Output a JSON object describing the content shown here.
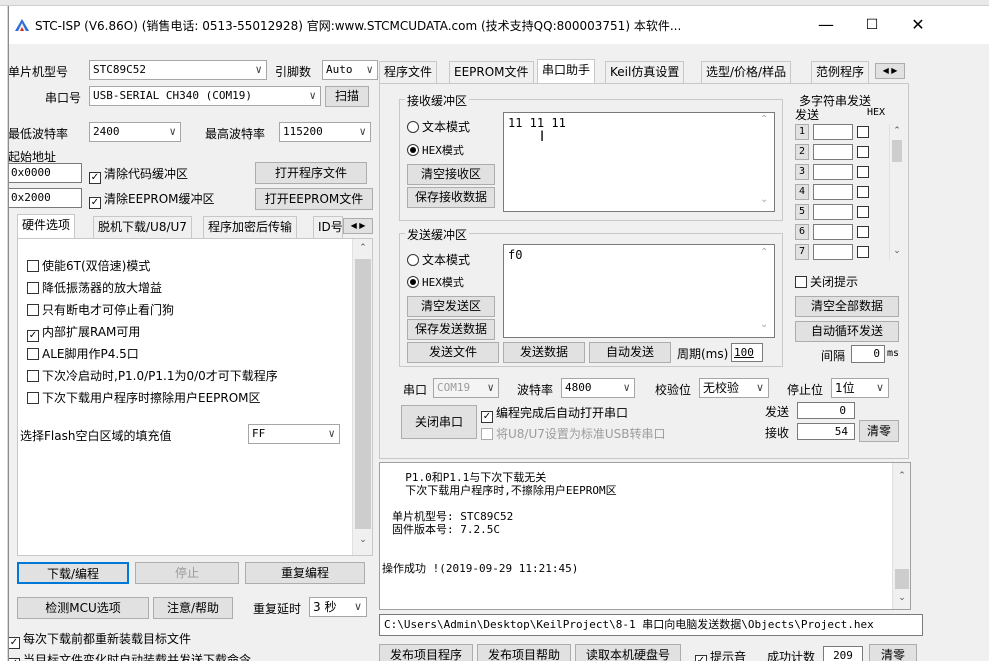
{
  "window": {
    "title": "STC-ISP (V6.86O) (销售电话: 0513-55012928) 官网:www.STCMCUDATA.com  (技术支持QQ:800003751) 本软件...",
    "minimize": "—",
    "maximize": "☐",
    "close": "✕"
  },
  "left": {
    "mcu_label": "单片机型号",
    "mcu_value": "STC89C52",
    "pins_label": "引脚数",
    "pins_value": "Auto",
    "port_label": "串口号",
    "port_value": "USB-SERIAL CH340 (COM19)",
    "scan_button": "扫描",
    "min_baud_label": "最低波特率",
    "min_baud_value": "2400",
    "max_baud_label": "最高波特率",
    "max_baud_value": "115200",
    "start_addr_label": "起始地址",
    "addr1_value": "0x0000",
    "clear_code_label": "清除代码缓冲区",
    "open_program_button": "打开程序文件",
    "addr2_value": "0x2000",
    "clear_eeprom_label": "清除EEPROM缓冲区",
    "open_eeprom_button": "打开EEPROM文件",
    "tabs": [
      "硬件选项",
      "脱机下载/U8/U7",
      "程序加密后传输",
      "ID号"
    ],
    "options": [
      {
        "label": "使能6T(双倍速)模式",
        "checked": false
      },
      {
        "label": "降低振荡器的放大增益",
        "checked": false
      },
      {
        "label": "只有断电才可停止看门狗",
        "checked": false
      },
      {
        "label": "内部扩展RAM可用",
        "checked": true
      },
      {
        "label": "ALE脚用作P4.5口",
        "checked": false
      },
      {
        "label": "下次冷启动时,P1.0/P1.1为0/0才可下载程序",
        "checked": false
      },
      {
        "label": "下次下载用户程序时擦除用户EEPROM区",
        "checked": false
      }
    ],
    "fill_label": "选择Flash空白区域的填充值",
    "fill_value": "FF",
    "download_button": "下载/编程",
    "stop_button": "停止",
    "reprogram_button": "重复编程",
    "detect_button": "检测MCU选项",
    "help_button": "注意/帮助",
    "delay_label": "重复延时",
    "delay_value": "3 秒",
    "reload_label": "每次下载前都重新装载目标文件",
    "autoload_label": "当目标文件变化时自动装载并发送下载命令"
  },
  "right": {
    "tabs": [
      "程序文件",
      "EEPROM文件",
      "串口助手",
      "Keil仿真设置",
      "选型/价格/样品",
      "范例程序"
    ],
    "recv_group": "接收缓冲区",
    "text_mode": "文本模式",
    "hex_mode": "HEX模式",
    "clear_recv": "清空接收区",
    "save_recv": "保存接收数据",
    "recv_content": "11 11 11",
    "send_group": "发送缓冲区",
    "clear_send": "清空发送区",
    "save_send": "保存发送数据",
    "send_content": "f0",
    "send_file": "发送文件",
    "send_data": "发送数据",
    "auto_send": "自动发送",
    "period_label": "周期(ms)",
    "period_value": "100",
    "multi_title": "多字符串发送",
    "multi_send": "发送",
    "multi_hex": "HEX",
    "multi_rows": [
      "1",
      "2",
      "3",
      "4",
      "5",
      "6",
      "7"
    ],
    "close_hint": "关闭提示",
    "clear_all": "清空全部数据",
    "auto_loop": "自动循环发送",
    "interval_label": "间隔",
    "interval_value": "0",
    "interval_unit": "ms",
    "port_label": "串口",
    "port_value": "COM19",
    "baud_label": "波特率",
    "baud_value": "4800",
    "parity_label": "校验位",
    "parity_value": "无校验",
    "stop_label": "停止位",
    "stop_value": "1位",
    "close_port": "关闭串口",
    "auto_open": "编程完成后自动打开串口",
    "usb_std": "将U8/U7设置为标准USB转串口",
    "sent_label": "发送",
    "sent_value": "0",
    "recv_label": "接收",
    "recv_value": "54",
    "clear_zero": "清零",
    "log_lines": [
      "  P1.0和P1.1与下次下载无关",
      "  下次下载用户程序时,不擦除用户EEPROM区",
      "",
      "单片机型号: STC89C52",
      "固件版本号: 7.2.5C",
      "",
      "",
      "操作成功 !(2019-09-29 11:21:45)"
    ],
    "path": "C:\\Users\\Admin\\Desktop\\KeilProject\\8-1 串口向电脑发送数据\\Objects\\Project.hex",
    "publish_program": "发布项目程序",
    "publish_help": "发布项目帮助",
    "read_disk": "读取本机硬盘号",
    "beep_label": "提示音",
    "success_label": "成功计数",
    "success_value": "209",
    "clear_count": "清零"
  }
}
